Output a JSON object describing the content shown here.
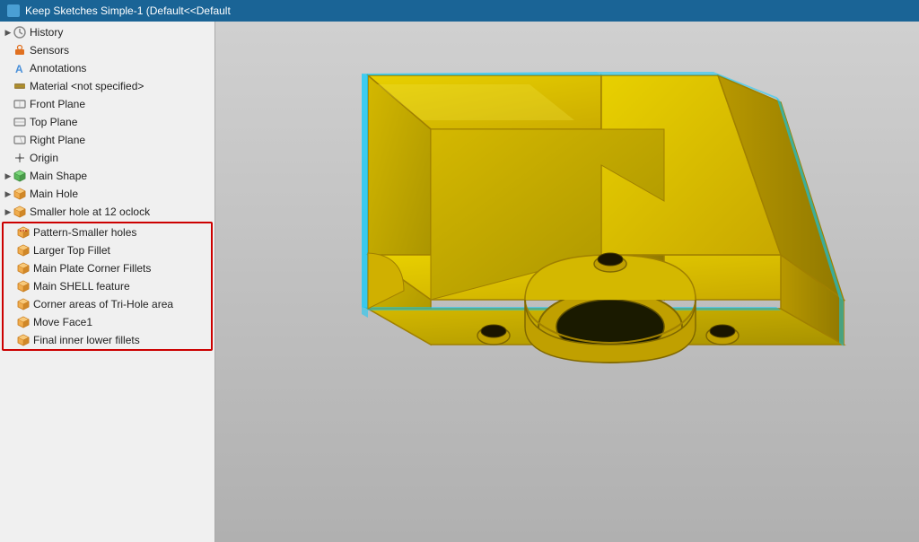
{
  "titleBar": {
    "label": "Keep Sketches Simple-1 (Default<<Default"
  },
  "sidebar": {
    "items": [
      {
        "id": "history",
        "label": "History",
        "icon": "history",
        "indent": 1,
        "expandable": true
      },
      {
        "id": "sensors",
        "label": "Sensors",
        "icon": "sensors",
        "indent": 1,
        "expandable": false
      },
      {
        "id": "annotations",
        "label": "Annotations",
        "icon": "annotations",
        "indent": 1,
        "expandable": false
      },
      {
        "id": "material",
        "label": "Material <not specified>",
        "icon": "material",
        "indent": 1,
        "expandable": false
      },
      {
        "id": "front-plane",
        "label": "Front Plane",
        "icon": "plane",
        "indent": 1,
        "expandable": false
      },
      {
        "id": "top-plane",
        "label": "Top Plane",
        "icon": "plane",
        "indent": 1,
        "expandable": false
      },
      {
        "id": "right-plane",
        "label": "Right Plane",
        "icon": "plane",
        "indent": 1,
        "expandable": false
      },
      {
        "id": "origin",
        "label": "Origin",
        "icon": "origin",
        "indent": 1,
        "expandable": false
      },
      {
        "id": "main-shape",
        "label": "Main Shape",
        "icon": "green-cube",
        "indent": 1,
        "expandable": true
      },
      {
        "id": "main-hole",
        "label": "Main Hole",
        "icon": "yellow-cube",
        "indent": 1,
        "expandable": true
      },
      {
        "id": "smaller-hole",
        "label": "Smaller hole at 12 oclock",
        "icon": "yellow-cube",
        "indent": 1,
        "expandable": true
      }
    ],
    "redGroupItems": [
      {
        "id": "pattern-smaller-holes",
        "label": "Pattern-Smaller holes",
        "icon": "yellow-cube"
      },
      {
        "id": "larger-top-fillet",
        "label": "Larger Top Fillet",
        "icon": "yellow-cube"
      },
      {
        "id": "main-plate-corner-fillets",
        "label": "Main Plate Corner Fillets",
        "icon": "yellow-cube"
      },
      {
        "id": "main-shell-feature",
        "label": "Main SHELL feature",
        "icon": "yellow-cube"
      },
      {
        "id": "corner-areas",
        "label": "Corner areas of Tri-Hole area",
        "icon": "yellow-cube"
      },
      {
        "id": "move-face1",
        "label": "Move Face1",
        "icon": "yellow-cube"
      },
      {
        "id": "final-inner-lower-fillets",
        "label": "Final inner lower fillets",
        "icon": "yellow-cube"
      }
    ]
  },
  "viewport": {
    "partColor": "#c8b400",
    "edgeColor": "#00ccff"
  }
}
